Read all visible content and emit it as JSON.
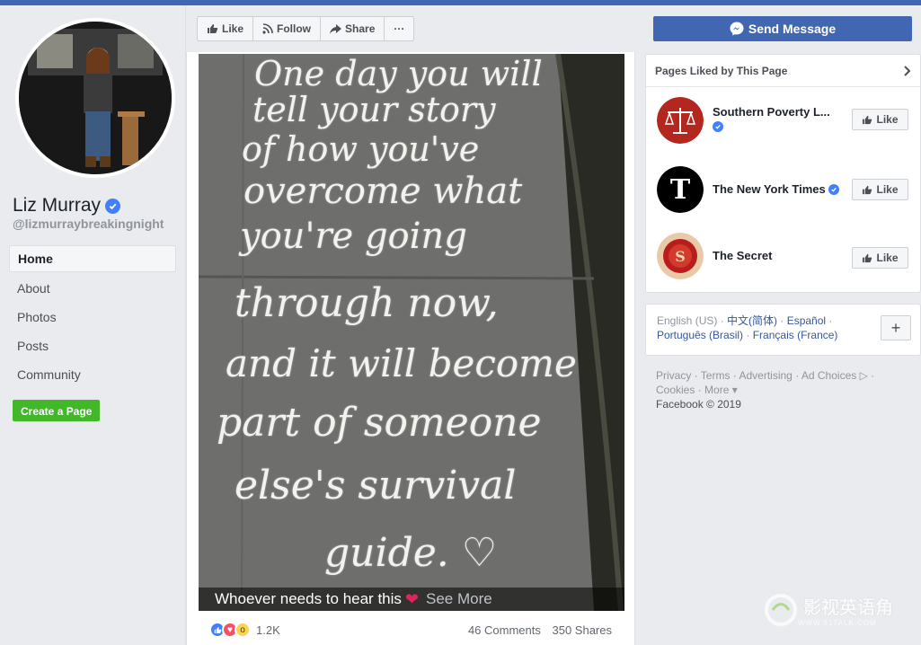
{
  "profile": {
    "name": "Liz Murray",
    "handle": "@lizmurraybreakingnight"
  },
  "nav": {
    "items": [
      "Home",
      "About",
      "Photos",
      "Posts",
      "Community"
    ],
    "create_page": "Create a Page"
  },
  "toolbar": {
    "like": "Like",
    "follow": "Follow",
    "share": "Share",
    "more": "···",
    "send_message": "Send Message"
  },
  "post": {
    "image_lines": [
      "One day you will",
      "tell your story",
      "of how you've",
      "overcome what",
      "you're going",
      "through now,",
      "and it will become",
      "part of someone",
      "else's survival",
      "guide. ♡"
    ],
    "caption": "Whoever needs to hear this",
    "see_more": "See More",
    "reaction_count": "1.2K",
    "comments": "46 Comments",
    "shares": "350 Shares"
  },
  "pages_liked": {
    "title": "Pages Liked by This Page",
    "pages": [
      {
        "name": "Southern Poverty L...",
        "verified": true,
        "like_label": "Like"
      },
      {
        "name": "The New York Times",
        "verified": true,
        "like_label": "Like"
      },
      {
        "name": "The Secret",
        "verified": false,
        "like_label": "Like"
      }
    ]
  },
  "languages": {
    "current": "English (US)",
    "links": [
      "中文(简体)",
      "Español",
      "Português (Brasil)",
      "Français (France)"
    ]
  },
  "footer": {
    "links": [
      "Privacy",
      "Terms",
      "Advertising",
      "Ad Choices",
      "Cookies",
      "More"
    ],
    "copyright": "Facebook © 2019"
  },
  "watermark": {
    "text": "影视英语角",
    "sub": "WWW.91TALK.COM"
  },
  "colors": {
    "brand": "#4267b2",
    "create_page": "#42b72a",
    "verified": "#4080ff"
  }
}
